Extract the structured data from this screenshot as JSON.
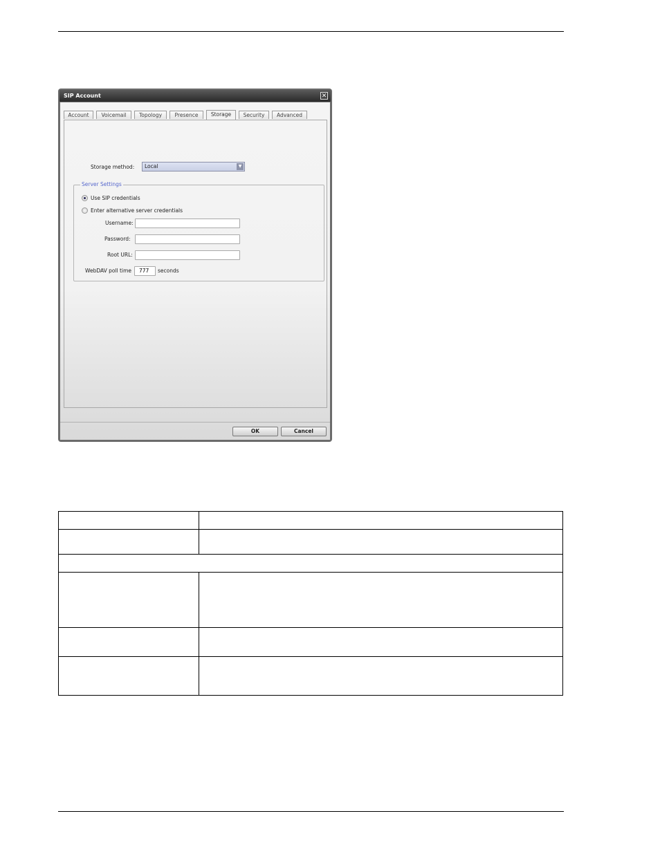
{
  "dialog": {
    "title": "SIP Account",
    "close_glyph": "✕",
    "tabs": [
      {
        "label": "Account"
      },
      {
        "label": "Voicemail"
      },
      {
        "label": "Topology"
      },
      {
        "label": "Presence"
      },
      {
        "label": "Storage"
      },
      {
        "label": "Security"
      },
      {
        "label": "Advanced"
      }
    ],
    "active_tab": "Storage",
    "storage_method_label": "Storage method:",
    "storage_method_value": "Local",
    "select_arrow_glyph": "▼",
    "server_settings_legend": "Server Settings",
    "radio_use_sip": "Use SIP credentials",
    "radio_alt": "Enter alternative server credentials",
    "username_label": "Username:",
    "username_value": "",
    "password_label": "Password:",
    "password_value": "",
    "root_url_label": "Root URL:",
    "root_url_value": "",
    "webdav_label": "WebDAV poll time",
    "webdav_value": "777",
    "webdav_unit": "seconds",
    "ok_label": "OK",
    "cancel_label": "Cancel"
  }
}
